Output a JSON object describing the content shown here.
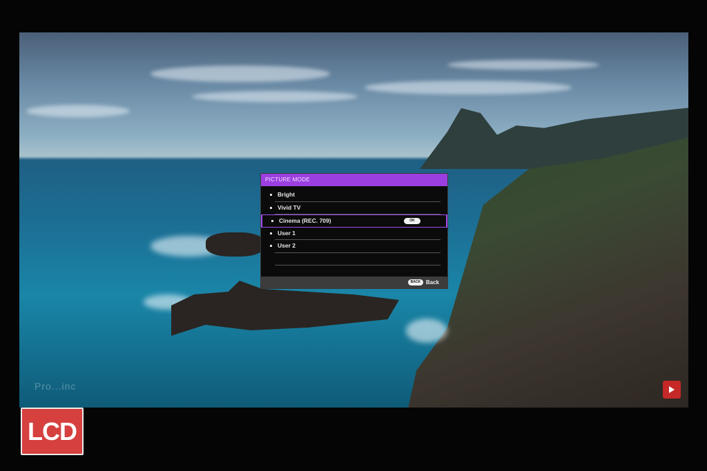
{
  "screen": {
    "watermark_text": "Pro...inc",
    "channel_badge_icon": "youtube-subscribe-icon"
  },
  "osd": {
    "title": "PICTURE MODE",
    "items": [
      {
        "label": "Bright",
        "selected": false
      },
      {
        "label": "Vivid TV",
        "selected": false
      },
      {
        "label": "Cinema (REC. 709)",
        "selected": true,
        "badge": "OK"
      },
      {
        "label": "User 1",
        "selected": false
      },
      {
        "label": "User 2",
        "selected": false
      }
    ],
    "footer": {
      "back_key": "BACK",
      "back_label": "Back"
    },
    "colors": {
      "accent": "#9c3fe0",
      "panel": "#0b0b0b",
      "footer": "#3c3c3c"
    }
  },
  "logo": {
    "text": "LCD",
    "color": "#d6403f"
  }
}
